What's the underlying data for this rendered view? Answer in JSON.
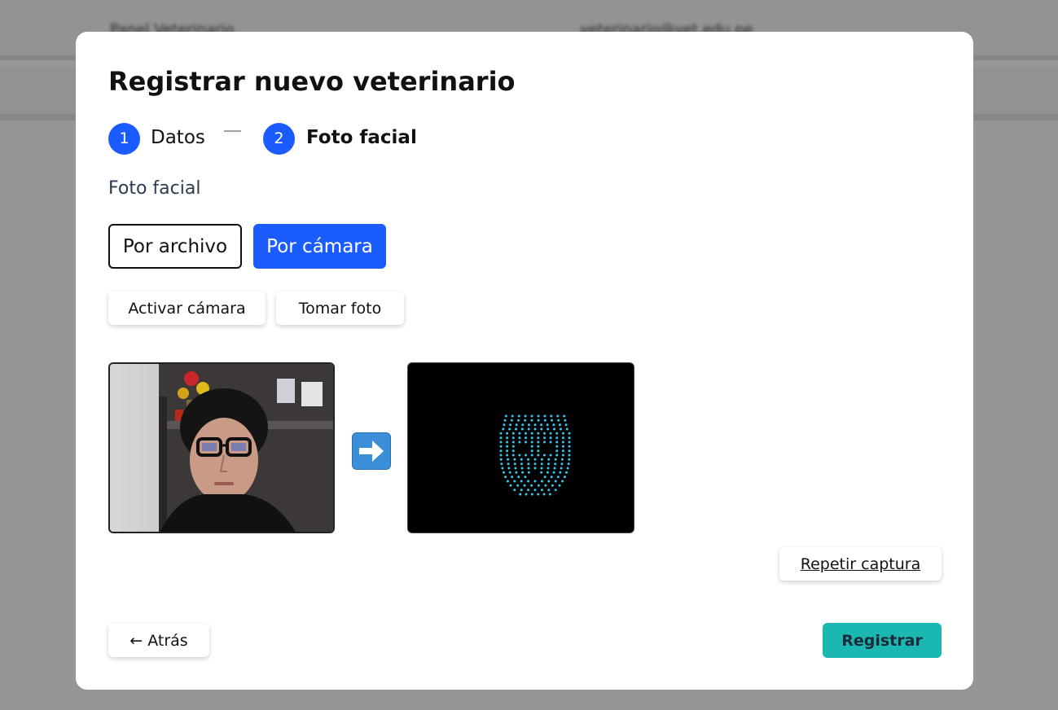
{
  "background": {
    "left_text": "Panel Veterinario",
    "right_text": "veterinario@vet.edu.pe"
  },
  "modal": {
    "title": "Registrar nuevo veterinario",
    "steps": [
      {
        "number": "1",
        "label": "Datos"
      },
      {
        "number": "2",
        "label": "Foto facial"
      }
    ],
    "section_label": "Foto facial",
    "mode_buttons": {
      "file": "Por archivo",
      "camera": "Por cámara",
      "selected": "camera"
    },
    "camera_buttons": {
      "activate": "Activar cámara",
      "capture": "Tomar foto"
    },
    "icons": {
      "arrow": "arrow-right-icon"
    },
    "repeat_button": "Repetir captura",
    "back_button": "← Atrás",
    "submit_button": "Registrar"
  },
  "colors": {
    "primary": "#1a5cff",
    "accent": "#1ab8b0",
    "mesh": "#35c8f0"
  }
}
